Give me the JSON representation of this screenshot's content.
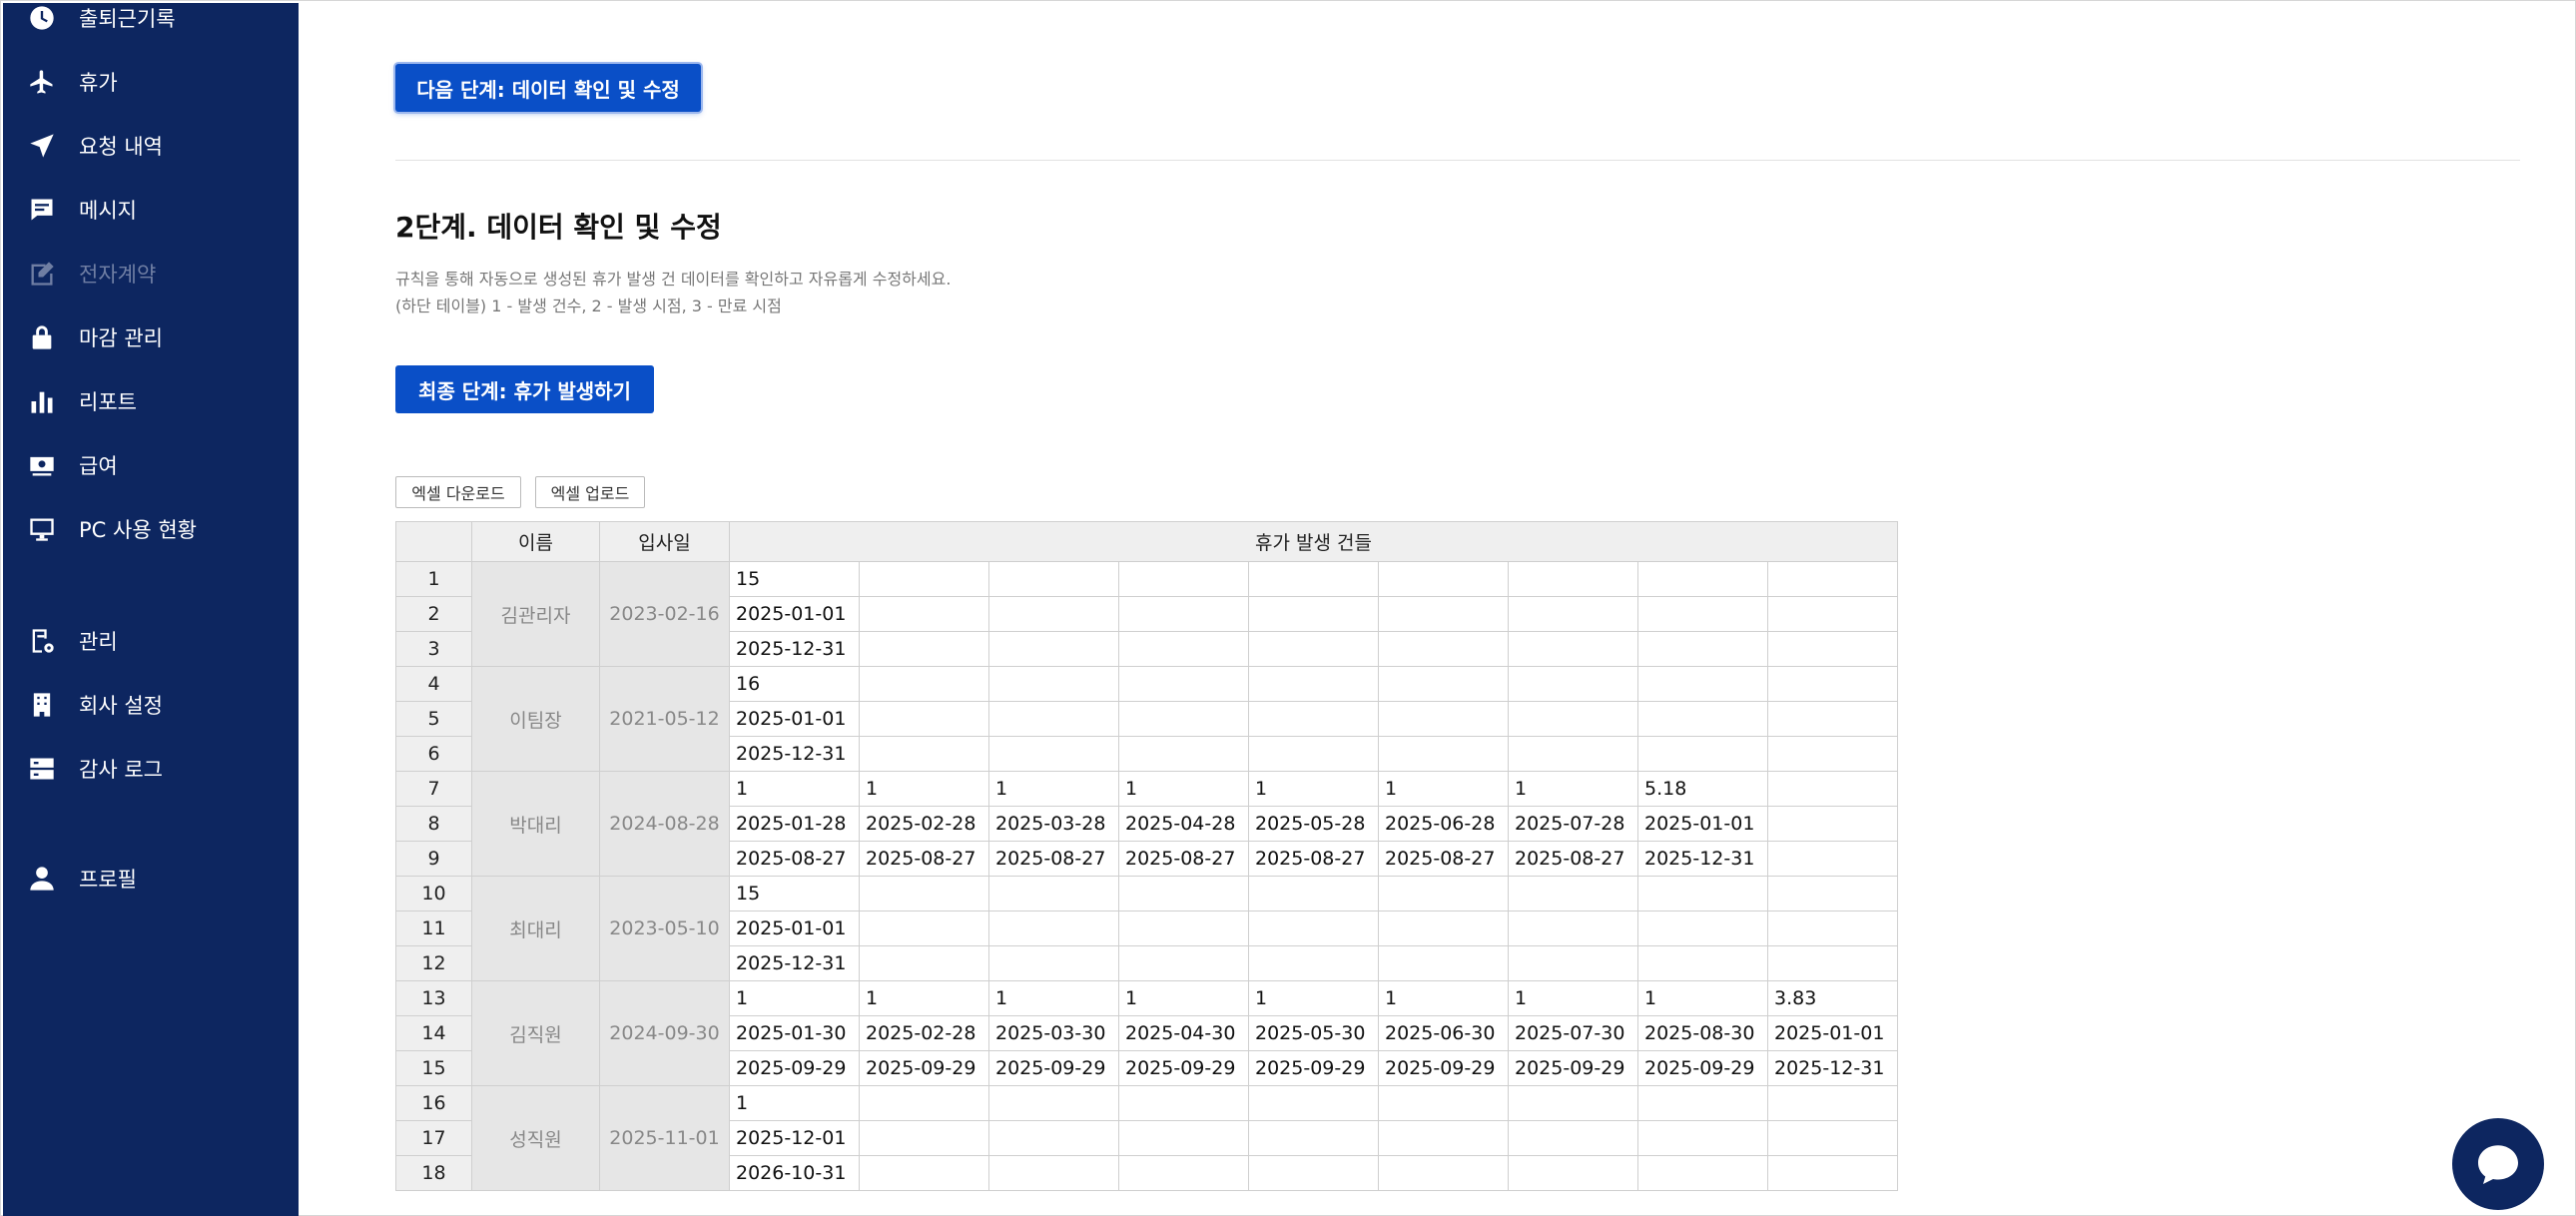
{
  "sidebar": {
    "items": [
      {
        "label": "출퇴근기록",
        "icon": "clock-icon",
        "disabled": false
      },
      {
        "label": "휴가",
        "icon": "airplane-icon",
        "disabled": false
      },
      {
        "label": "요청 내역",
        "icon": "send-icon",
        "disabled": false
      },
      {
        "label": "메시지",
        "icon": "message-icon",
        "disabled": false
      },
      {
        "label": "전자계약",
        "icon": "edit-icon",
        "disabled": true
      },
      {
        "label": "마감 관리",
        "icon": "lock-icon",
        "disabled": false
      },
      {
        "label": "리포트",
        "icon": "bar-chart-icon",
        "disabled": false
      },
      {
        "label": "급여",
        "icon": "money-icon",
        "disabled": false
      },
      {
        "label": "PC 사용 현황",
        "icon": "monitor-icon",
        "disabled": false
      },
      {
        "label": "관리",
        "icon": "settings-doc-icon",
        "disabled": false
      },
      {
        "label": "회사 설정",
        "icon": "building-icon",
        "disabled": false
      },
      {
        "label": "감사 로그",
        "icon": "server-icon",
        "disabled": false
      },
      {
        "label": "프로필",
        "icon": "person-icon",
        "disabled": false
      }
    ]
  },
  "main": {
    "next_button": "다음 단계: 데이터 확인 및 수정",
    "step_title": "2단계. 데이터 확인 및 수정",
    "desc_line1": "규칙을 통해 자동으로 생성된 휴가 발생 건 데이터를 확인하고 자유롭게 수정하세요.",
    "desc_line2": "(하단 테이블) 1 - 발생 건수, 2 - 발생 시점, 3 - 만료 시점",
    "final_button": "최종 단계: 휴가 발생하기",
    "excel_download": "엑셀 다운로드",
    "excel_upload": "엑셀 업로드"
  },
  "table": {
    "headers": {
      "name": "이름",
      "join_date": "입사일",
      "grants": "휴가 발생 건들"
    },
    "groups": [
      {
        "name": "김관리자",
        "join_date": "2023-02-16",
        "rows": [
          [
            "15",
            "",
            "",
            "",
            "",
            "",
            "",
            "",
            ""
          ],
          [
            "2025-01-01",
            "",
            "",
            "",
            "",
            "",
            "",
            "",
            ""
          ],
          [
            "2025-12-31",
            "",
            "",
            "",
            "",
            "",
            "",
            "",
            ""
          ]
        ]
      },
      {
        "name": "이팀장",
        "join_date": "2021-05-12",
        "rows": [
          [
            "16",
            "",
            "",
            "",
            "",
            "",
            "",
            "",
            ""
          ],
          [
            "2025-01-01",
            "",
            "",
            "",
            "",
            "",
            "",
            "",
            ""
          ],
          [
            "2025-12-31",
            "",
            "",
            "",
            "",
            "",
            "",
            "",
            ""
          ]
        ]
      },
      {
        "name": "박대리",
        "join_date": "2024-08-28",
        "rows": [
          [
            "1",
            "1",
            "1",
            "1",
            "1",
            "1",
            "1",
            "5.18",
            ""
          ],
          [
            "2025-01-28",
            "2025-02-28",
            "2025-03-28",
            "2025-04-28",
            "2025-05-28",
            "2025-06-28",
            "2025-07-28",
            "2025-01-01",
            ""
          ],
          [
            "2025-08-27",
            "2025-08-27",
            "2025-08-27",
            "2025-08-27",
            "2025-08-27",
            "2025-08-27",
            "2025-08-27",
            "2025-12-31",
            ""
          ]
        ]
      },
      {
        "name": "최대리",
        "join_date": "2023-05-10",
        "rows": [
          [
            "15",
            "",
            "",
            "",
            "",
            "",
            "",
            "",
            ""
          ],
          [
            "2025-01-01",
            "",
            "",
            "",
            "",
            "",
            "",
            "",
            ""
          ],
          [
            "2025-12-31",
            "",
            "",
            "",
            "",
            "",
            "",
            "",
            ""
          ]
        ]
      },
      {
        "name": "김직원",
        "join_date": "2024-09-30",
        "rows": [
          [
            "1",
            "1",
            "1",
            "1",
            "1",
            "1",
            "1",
            "1",
            "3.83"
          ],
          [
            "2025-01-30",
            "2025-02-28",
            "2025-03-30",
            "2025-04-30",
            "2025-05-30",
            "2025-06-30",
            "2025-07-30",
            "2025-08-30",
            "2025-01-01"
          ],
          [
            "2025-09-29",
            "2025-09-29",
            "2025-09-29",
            "2025-09-29",
            "2025-09-29",
            "2025-09-29",
            "2025-09-29",
            "2025-09-29",
            "2025-12-31"
          ]
        ]
      },
      {
        "name": "성직원",
        "join_date": "2025-11-01",
        "rows": [
          [
            "1",
            "",
            "",
            "",
            "",
            "",
            "",
            "",
            ""
          ],
          [
            "2025-12-01",
            "",
            "",
            "",
            "",
            "",
            "",
            "",
            ""
          ],
          [
            "2026-10-31",
            "",
            "",
            "",
            "",
            "",
            "",
            "",
            ""
          ]
        ]
      }
    ]
  }
}
